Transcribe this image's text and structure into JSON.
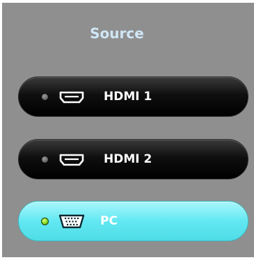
{
  "menu": {
    "title": "Source",
    "items": [
      {
        "label": "HDMI 1",
        "icon": "hdmi-port-icon",
        "selected": false
      },
      {
        "label": "HDMI 2",
        "icon": "hdmi-port-icon",
        "selected": false
      },
      {
        "label": "PC",
        "icon": "vga-port-icon",
        "selected": true
      }
    ]
  },
  "colors": {
    "panel_background": "#8f8f8f",
    "title_text": "#cfe6f5",
    "selected_background": "#62e8f2",
    "unselected_background": "#000000",
    "active_indicator": "#7dd21f",
    "inactive_indicator": "#6a6a6a"
  }
}
